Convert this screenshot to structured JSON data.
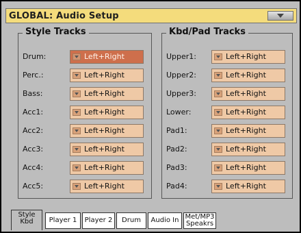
{
  "header": {
    "title": "GLOBAL: Audio Setup"
  },
  "style_tracks": {
    "title": "Style Tracks",
    "rows": [
      {
        "label": "Drum:",
        "value": "Left+Right"
      },
      {
        "label": "Perc.:",
        "value": "Left+Right"
      },
      {
        "label": "Bass:",
        "value": "Left+Right"
      },
      {
        "label": "Acc1:",
        "value": "Left+Right"
      },
      {
        "label": "Acc2:",
        "value": "Left+Right"
      },
      {
        "label": "Acc3:",
        "value": "Left+Right"
      },
      {
        "label": "Acc4:",
        "value": "Left+Right"
      },
      {
        "label": "Acc5:",
        "value": "Left+Right"
      }
    ]
  },
  "kbd_pad_tracks": {
    "title": "Kbd/Pad Tracks",
    "rows": [
      {
        "label": "Upper1:",
        "value": "Left+Right"
      },
      {
        "label": "Upper2:",
        "value": "Left+Right"
      },
      {
        "label": "Upper3:",
        "value": "Left+Right"
      },
      {
        "label": "Lower:",
        "value": "Left+Right"
      },
      {
        "label": "Pad1:",
        "value": "Left+Right"
      },
      {
        "label": "Pad2:",
        "value": "Left+Right"
      },
      {
        "label": "Pad3:",
        "value": "Left+Right"
      },
      {
        "label": "Pad4:",
        "value": "Left+Right"
      }
    ]
  },
  "tabs": [
    {
      "line1": "Style",
      "line2": "Kbd",
      "active": true
    },
    {
      "line1": "Player 1",
      "line2": ""
    },
    {
      "line1": "Player 2",
      "line2": ""
    },
    {
      "line1": "Drum",
      "line2": ""
    },
    {
      "line1": "Audio In",
      "line2": ""
    },
    {
      "line1": "Met/MP3",
      "line2": "Speakrs"
    }
  ],
  "colors": {
    "title_bar": "#f4dc7c",
    "selector": "#efc9a6",
    "selector_active": "#ce6f4c",
    "background": "#bdbdbd"
  }
}
